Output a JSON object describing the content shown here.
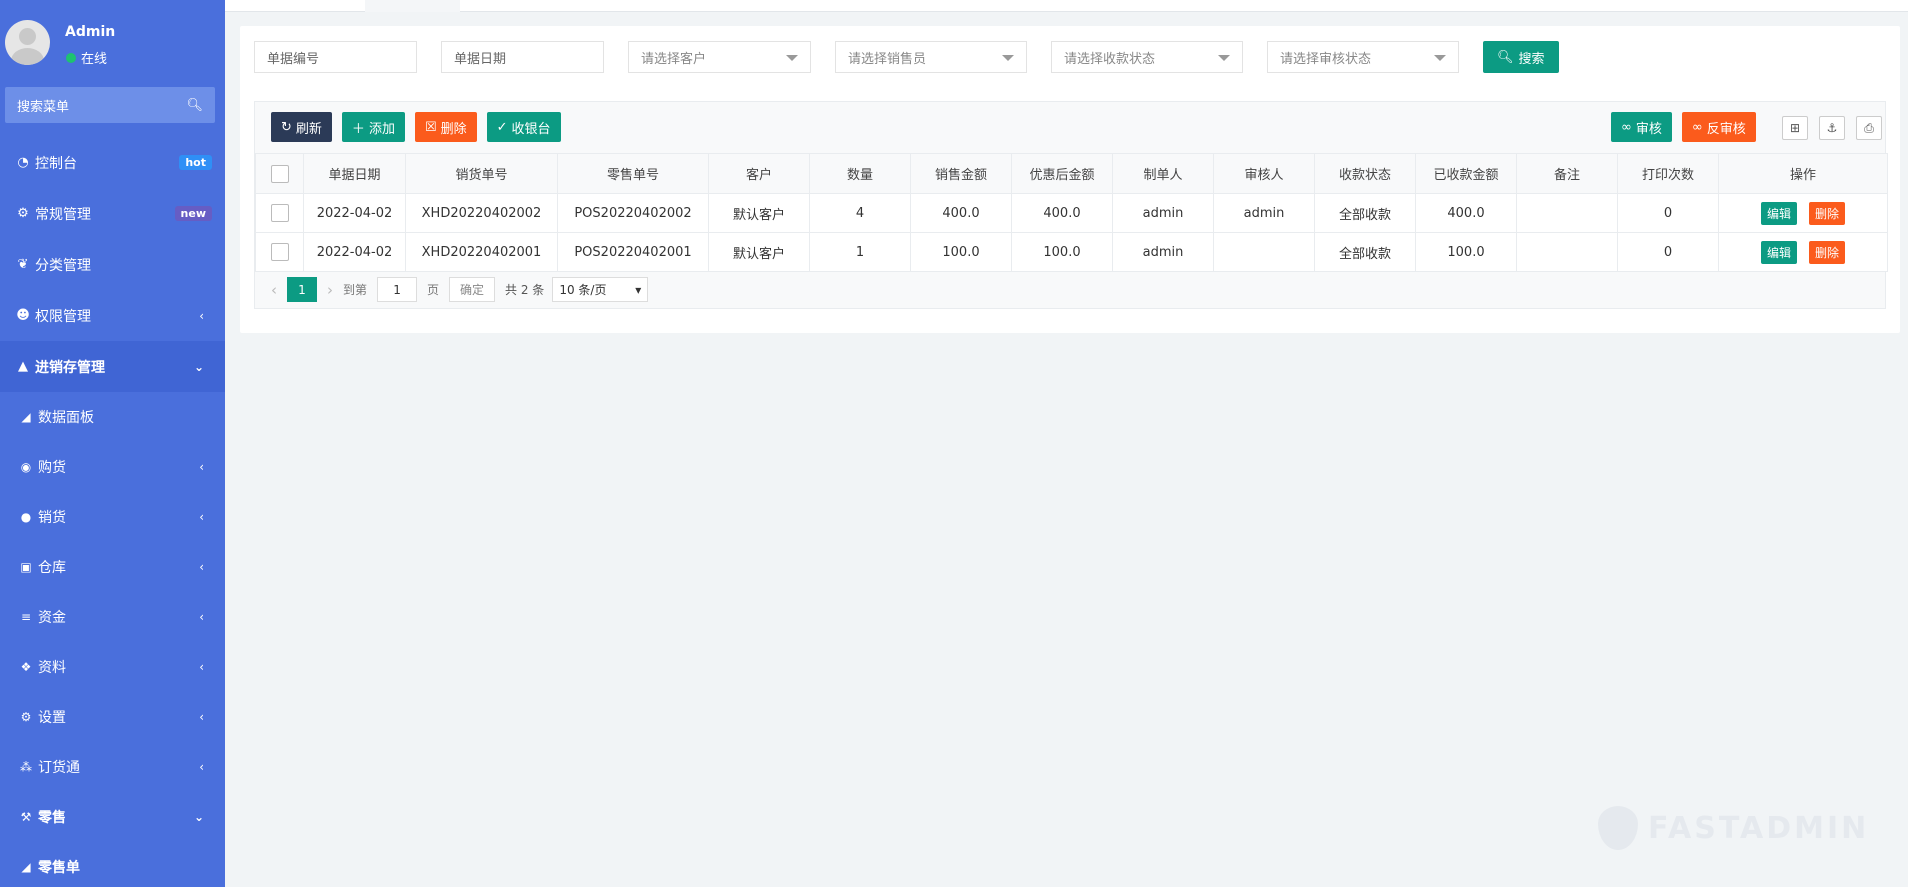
{
  "colors": {
    "sidebar": "#4a6fdc",
    "teal": "#0c9b83",
    "orange": "#fb5b1c",
    "dark": "#2b3a57"
  },
  "user": {
    "name": "Admin",
    "status": "在线"
  },
  "menu_search": {
    "placeholder": "搜索菜单",
    "icon": "search-icon"
  },
  "nav": {
    "dashboard": {
      "label": "控制台",
      "badge": "hot",
      "icon": "dashboard-icon"
    },
    "general": {
      "label": "常规管理",
      "badge": "new",
      "icon": "cogs-icon"
    },
    "category": {
      "label": "分类管理",
      "icon": "leaf-icon"
    },
    "auth": {
      "label": "权限管理",
      "icon": "group-icon"
    },
    "inventory": {
      "label": "进销存管理",
      "icon": "graduation-cap-icon"
    },
    "inventory_sub": [
      {
        "label": "数据面板",
        "icon": "area-chart-icon"
      },
      {
        "label": "购货",
        "icon": "github-icon"
      },
      {
        "label": "销货",
        "icon": "apple-icon"
      },
      {
        "label": "仓库",
        "icon": "safe-icon"
      },
      {
        "label": "资金",
        "icon": "database-icon"
      },
      {
        "label": "资料",
        "icon": "cubes-icon"
      },
      {
        "label": "设置",
        "icon": "cogs-icon"
      },
      {
        "label": "订货通",
        "icon": "connectdevelop-icon"
      }
    ],
    "retail": {
      "label": "零售",
      "icon": "gavel-icon"
    },
    "retail_sub": [
      {
        "label": "零售单",
        "icon": "area-chart-icon"
      }
    ]
  },
  "filters": {
    "doc_no": "单据编号",
    "doc_date": "单据日期",
    "customer": "请选择客户",
    "salesman": "请选择销售员",
    "payment_status": "请选择收款状态",
    "audit_status": "请选择审核状态",
    "search_btn": "搜索"
  },
  "toolbar": {
    "refresh": "刷新",
    "add": "添加",
    "delete": "删除",
    "cashier": "收银台",
    "audit": "审核",
    "unaudit": "反审核"
  },
  "table": {
    "headers": [
      "单据日期",
      "销货单号",
      "零售单号",
      "客户",
      "数量",
      "销售金额",
      "优惠后金额",
      "制单人",
      "审核人",
      "收款状态",
      "已收款金额",
      "备注",
      "打印次数",
      "操作"
    ],
    "rows": [
      [
        "2022-04-02",
        "XHD20220402002",
        "POS20220402002",
        "默认客户",
        "4",
        "400.0",
        "400.0",
        "admin",
        "admin",
        "全部收款",
        "400.0",
        "",
        "0"
      ],
      [
        "2022-04-02",
        "XHD20220402001",
        "POS20220402001",
        "默认客户",
        "1",
        "100.0",
        "100.0",
        "admin",
        "",
        "全部收款",
        "100.0",
        "",
        "0"
      ]
    ],
    "edit_label": "编辑",
    "delete_label": "删除"
  },
  "pager": {
    "current": "1",
    "goto_label": "到第",
    "goto_value": "1",
    "page_label": "页",
    "confirm": "确定",
    "total": "共 2 条",
    "page_size": "10 条/页"
  },
  "watermark": "FASTADMIN"
}
